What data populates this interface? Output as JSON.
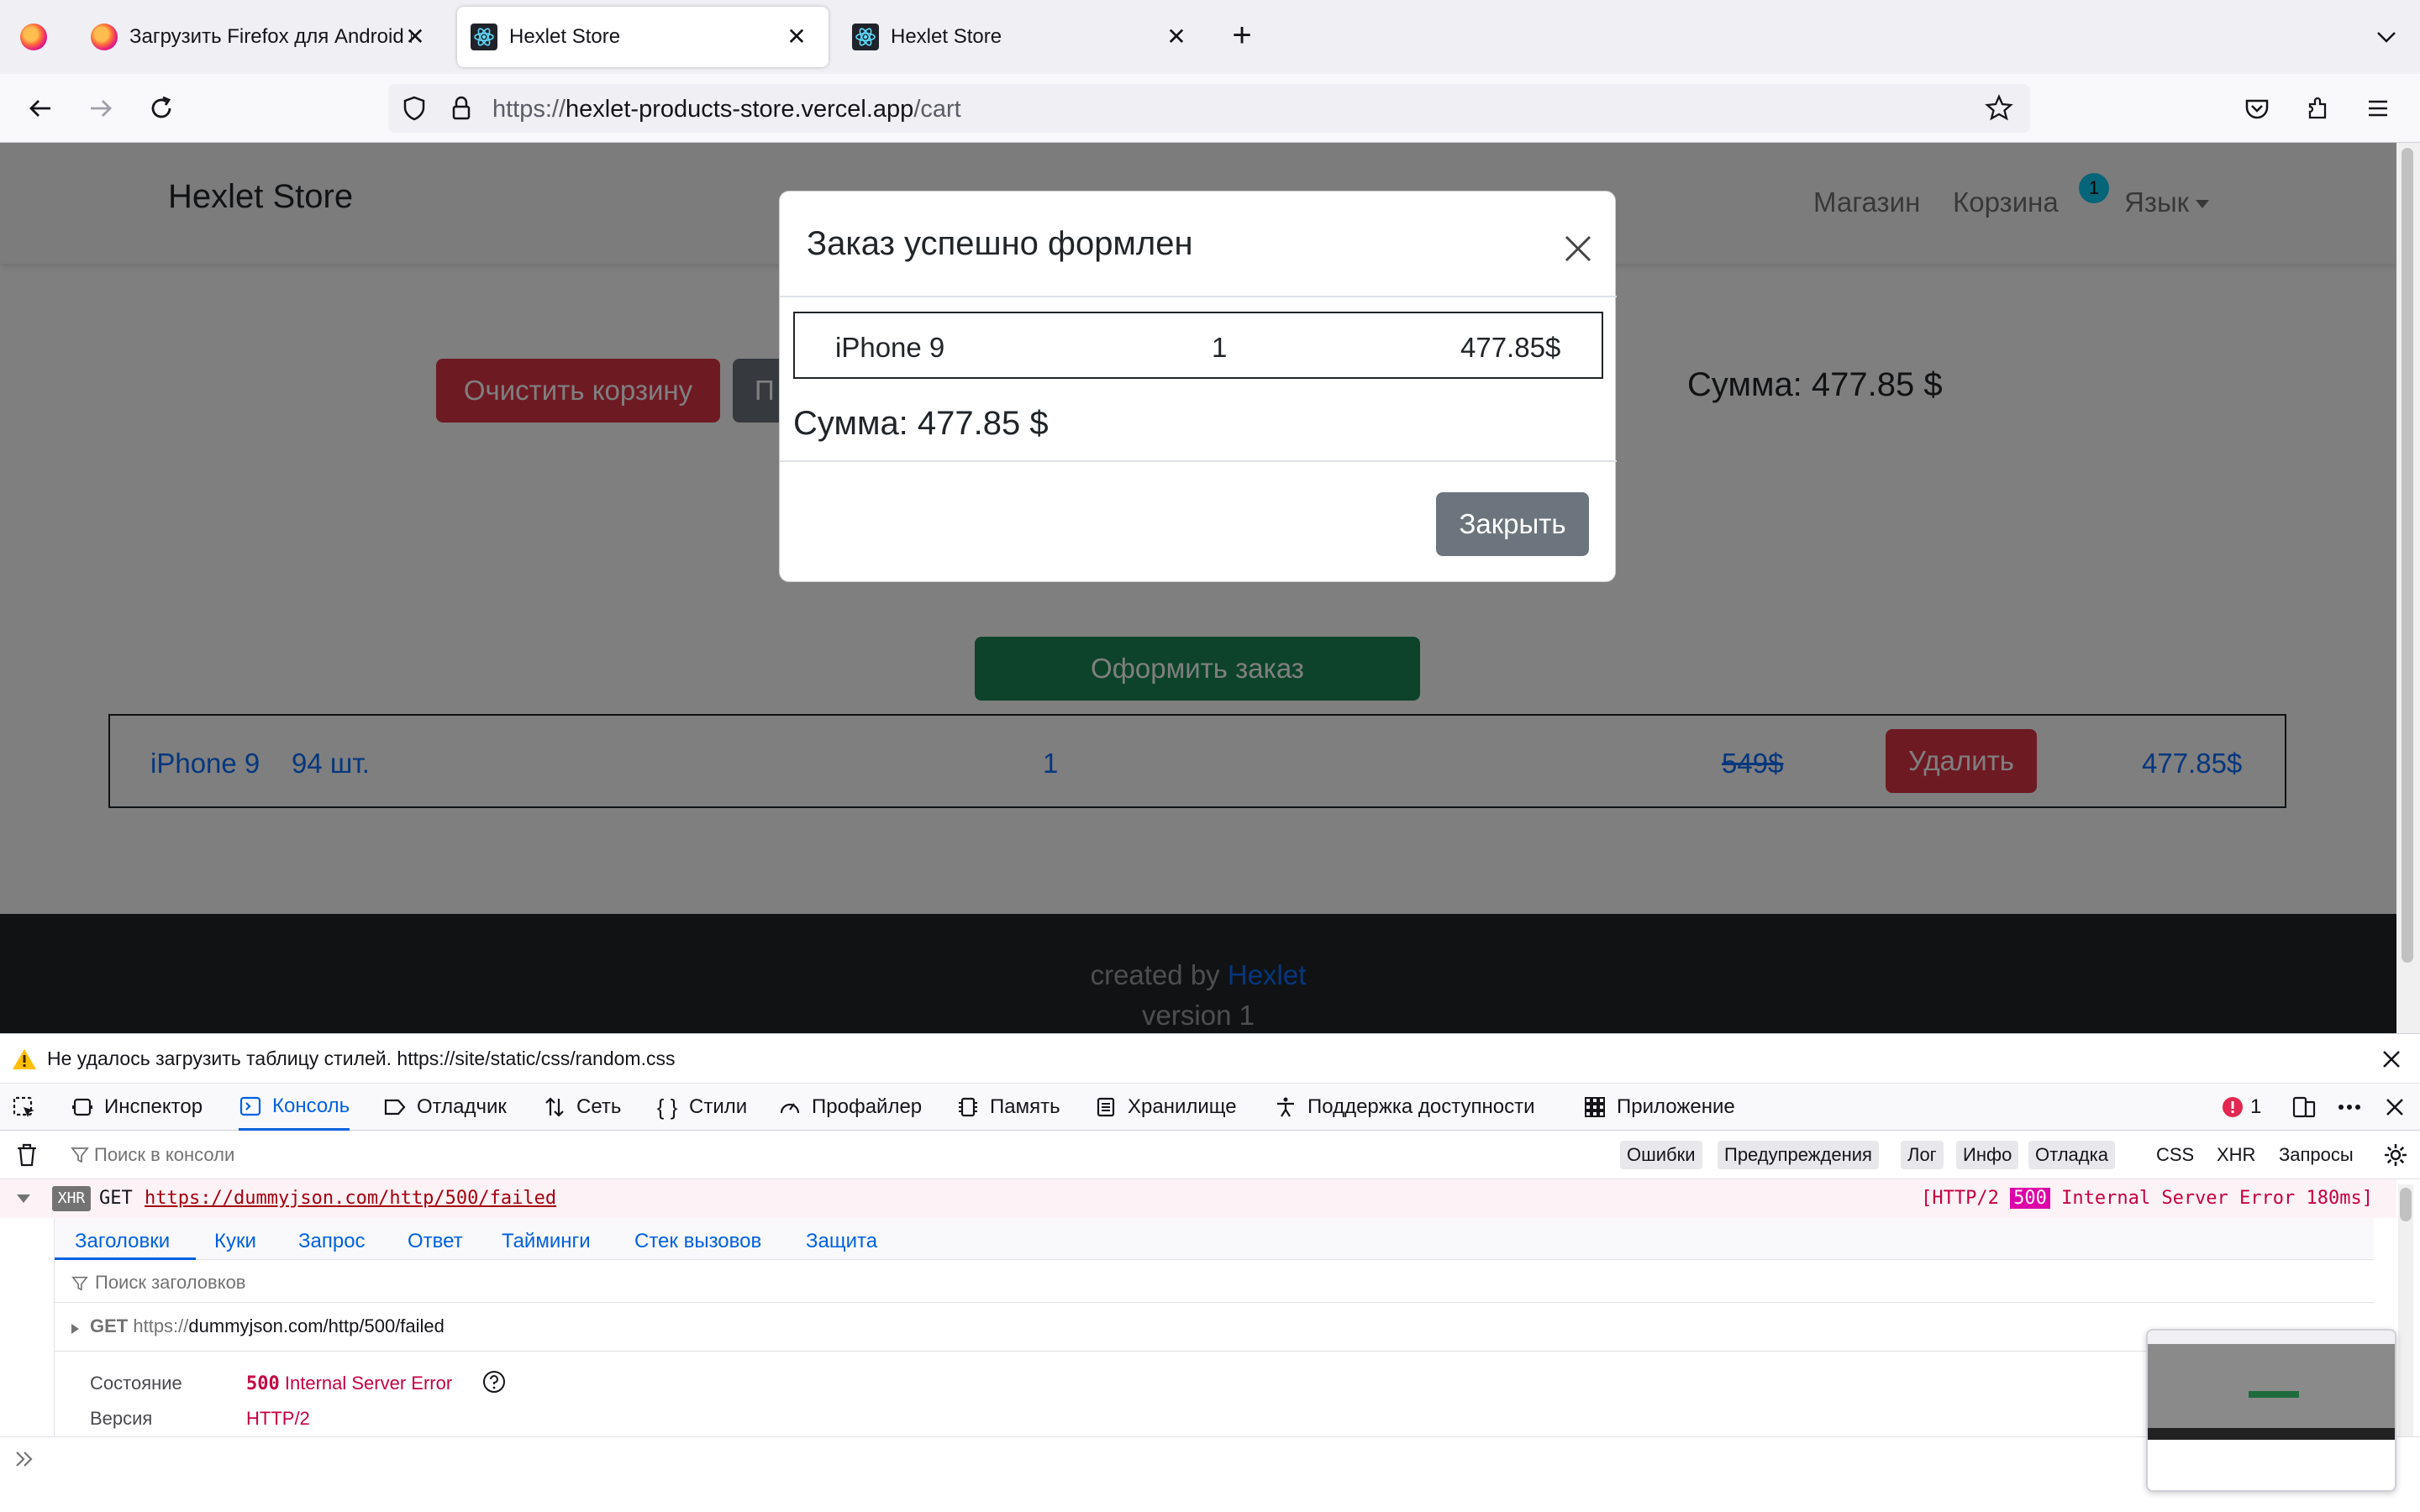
{
  "browser": {
    "tabs": [
      {
        "title": "Загрузить Firefox для Android и",
        "active": false
      },
      {
        "title": "Hexlet Store",
        "active": true
      },
      {
        "title": "Hexlet Store",
        "active": false
      }
    ],
    "url_scheme": "https://",
    "url_host": "hexlet-products-store.vercel.app",
    "url_path": "/cart"
  },
  "site": {
    "brand": "Hexlet Store",
    "nav": {
      "shop": "Магазин",
      "cart": "Корзина",
      "cart_count": "1",
      "language": "Язык"
    },
    "buttons": {
      "clear_cart": "Очистить корзину",
      "second_partial": "П",
      "checkout": "Оформить заказ",
      "delete": "Удалить"
    },
    "total": "Сумма: 477.85 $",
    "cart_row": {
      "name": "iPhone 9",
      "stock": "94 шт.",
      "qty": "1",
      "old_price": "549$",
      "price": "477.85$"
    },
    "footer": {
      "created_by": "created by",
      "link": "Hexlet",
      "version": "version 1"
    }
  },
  "modal": {
    "title": "Заказ успешно формлен",
    "item": {
      "name": "iPhone 9",
      "qty": "1",
      "price": "477.85$"
    },
    "total": "Сумма: 477.85 $",
    "close_label": "Закрыть"
  },
  "devtools": {
    "warning": "Не удалось загрузить таблицу стилей. https://site/static/css/random.css",
    "tabs": [
      "Инспектор",
      "Консоль",
      "Отладчик",
      "Сеть",
      "Стили",
      "Профайлер",
      "Память",
      "Хранилище",
      "Поддержка доступности",
      "Приложение"
    ],
    "error_count": "1",
    "filter_placeholder": "Поиск в консоли",
    "filters": [
      "Ошибки",
      "Предупреждения",
      "Лог",
      "Инфо",
      "Отладка",
      "CSS",
      "XHR",
      "Запросы"
    ],
    "request": {
      "badge": "XHR",
      "method": "GET",
      "url": "https://dummyjson.com/http/500/failed",
      "status_prefix": "[HTTP/2",
      "status_code": "500",
      "status_suffix": "Internal Server Error 180ms]",
      "panel_tabs": [
        "Заголовки",
        "Куки",
        "Запрос",
        "Ответ",
        "Тайминги",
        "Стек вызовов",
        "Защита"
      ],
      "header_search": "Поиск заголовков",
      "summary_method": "GET",
      "summary_scheme": "https://",
      "summary_rest": "dummyjson.com/http/500/failed",
      "state_label": "Состояние",
      "state_code": "500",
      "state_text": "Internal Server Error",
      "version_label": "Версия",
      "version_value": "HTTP/2"
    }
  }
}
